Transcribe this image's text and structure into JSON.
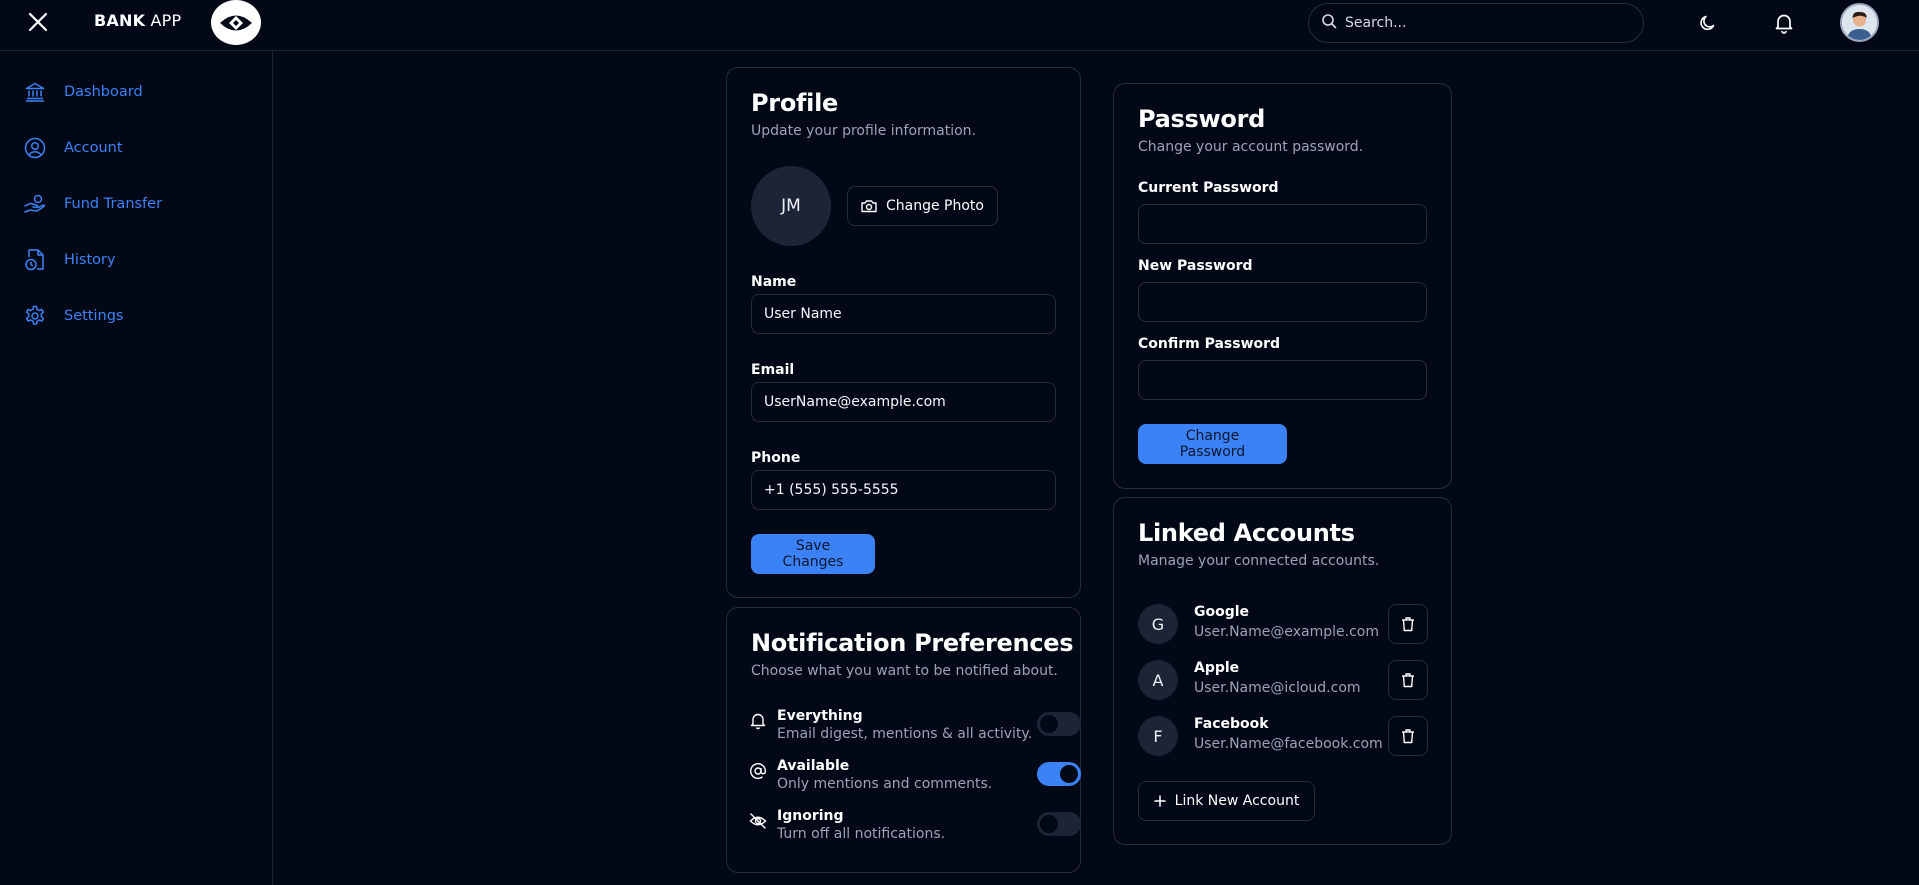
{
  "app": {
    "brand_bold": "BANK",
    "brand_light": "APP"
  },
  "search": {
    "placeholder": "Search..."
  },
  "sidebar": {
    "items": [
      {
        "label": "Dashboard",
        "icon": "bank-icon"
      },
      {
        "label": "Account",
        "icon": "user-circle-icon"
      },
      {
        "label": "Fund Transfer",
        "icon": "hand-coins-icon"
      },
      {
        "label": "History",
        "icon": "file-clock-icon"
      },
      {
        "label": "Settings",
        "icon": "gear-icon"
      }
    ]
  },
  "profile": {
    "title": "Profile",
    "subtitle": "Update your profile information.",
    "initials": "JM",
    "change_photo": "Change Photo",
    "name_label": "Name",
    "name_value": "User Name",
    "email_label": "Email",
    "email_value": "UserName@example.com",
    "phone_label": "Phone",
    "phone_value": "+1 (555) 555-5555",
    "save": "Save Changes"
  },
  "password": {
    "title": "Password",
    "subtitle": "Change your account password.",
    "current_label": "Current Password",
    "new_label": "New Password",
    "confirm_label": "Confirm Password",
    "submit": "Change Password"
  },
  "notifications": {
    "title": "Notification Preferences",
    "subtitle": "Choose what you want to be notified about.",
    "items": [
      {
        "title": "Everything",
        "desc": "Email digest, mentions & all activity.",
        "enabled": false,
        "icon": "bell-icon"
      },
      {
        "title": "Available",
        "desc": "Only mentions and comments.",
        "enabled": true,
        "icon": "at-sign-icon"
      },
      {
        "title": "Ignoring",
        "desc": "Turn off all notifications.",
        "enabled": false,
        "icon": "eye-off-icon"
      }
    ]
  },
  "linked": {
    "title": "Linked Accounts",
    "subtitle": "Manage your connected accounts.",
    "accounts": [
      {
        "initial": "G",
        "name": "Google",
        "email": "User.Name@example.com"
      },
      {
        "initial": "A",
        "name": "Apple",
        "email": "User.Name@icloud.com"
      },
      {
        "initial": "F",
        "name": "Facebook",
        "email": "User.Name@facebook.com"
      }
    ],
    "link_new": "Link New Account"
  },
  "colors": {
    "accent": "#3b82f6",
    "background": "#030817",
    "border": "#262d3c",
    "muted_text": "#9aa3b5"
  }
}
